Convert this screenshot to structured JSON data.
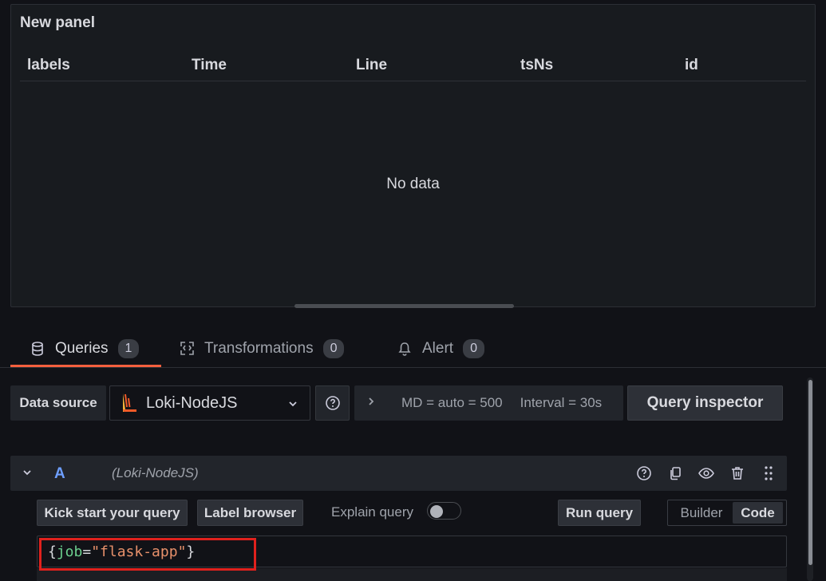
{
  "panel": {
    "title": "New panel",
    "columns": [
      "labels",
      "Time",
      "Line",
      "tsNs",
      "id"
    ],
    "empty_message": "No data"
  },
  "tabs": [
    {
      "label": "Queries",
      "count": "1",
      "icon": "database-icon",
      "active": true
    },
    {
      "label": "Transformations",
      "count": "0",
      "icon": "transform-icon",
      "active": false
    },
    {
      "label": "Alert",
      "count": "0",
      "icon": "bell-icon",
      "active": false
    }
  ],
  "datasource": {
    "label": "Data source",
    "selected": "Loki-NodeJS",
    "options_md": "MD = auto = 500",
    "options_interval": "Interval = 30s",
    "query_inspector": "Query inspector"
  },
  "query": {
    "ref_id": "A",
    "datasource_hint": "(Loki-NodeJS)",
    "kick_start": "Kick start your query",
    "label_browser": "Label browser",
    "explain_label": "Explain query",
    "explain_enabled": false,
    "run_query": "Run query",
    "mode_builder": "Builder",
    "mode_code": "Code",
    "active_mode": "Code",
    "code": {
      "open_brace": "{",
      "key": "job",
      "eq": "=",
      "value": "\"flask-app\"",
      "close_brace": "}"
    }
  },
  "colors": {
    "accent_tab": "#f55f3e",
    "ref_id": "#6e9fff",
    "highlight": "#e0211d"
  }
}
